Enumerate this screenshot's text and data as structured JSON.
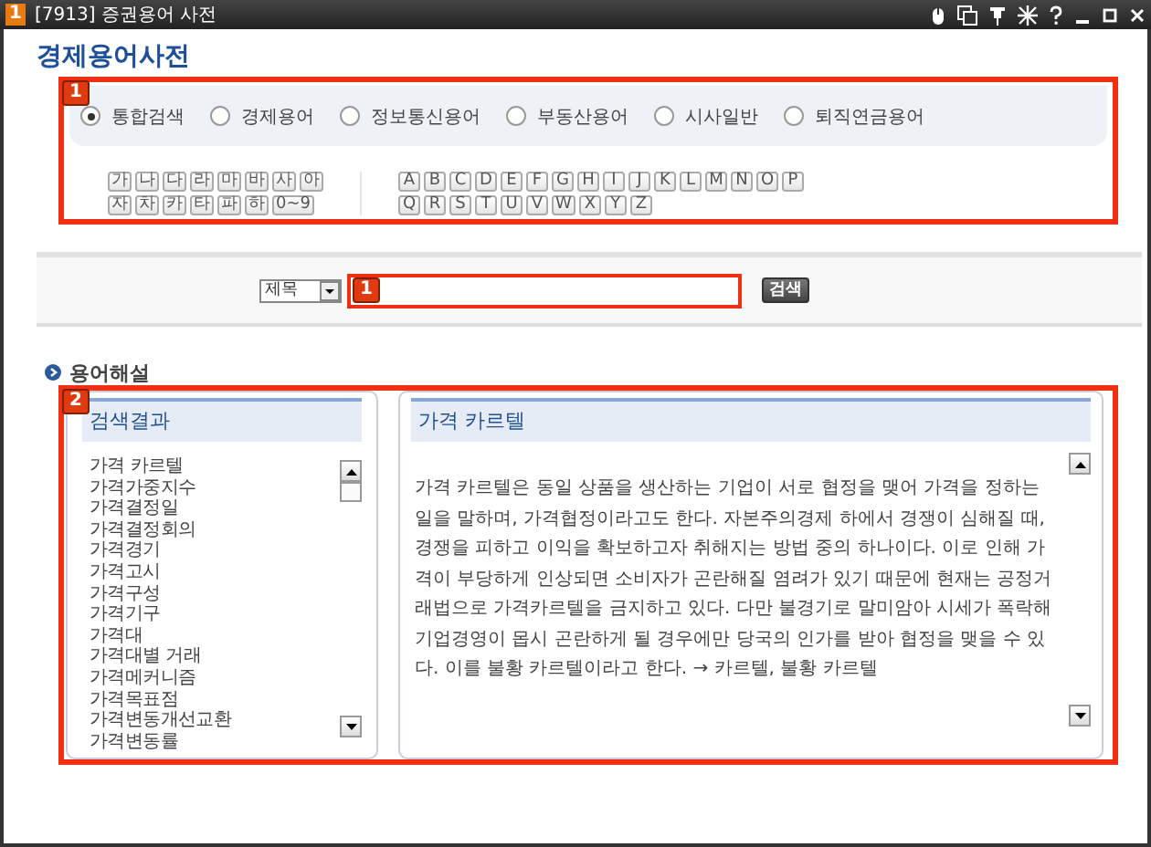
{
  "window": {
    "badge": "1",
    "title": "[7913] 증권용어 사전"
  },
  "heading": "경제용어사전",
  "category_panel": {
    "badge": "1",
    "options": [
      {
        "label": "통합검색",
        "selected": true
      },
      {
        "label": "경제용어",
        "selected": false
      },
      {
        "label": "정보통신용어",
        "selected": false
      },
      {
        "label": "부동산용어",
        "selected": false
      },
      {
        "label": "시사일반",
        "selected": false
      },
      {
        "label": "퇴직연금용어",
        "selected": false
      }
    ],
    "korean_index": [
      [
        "가",
        "나",
        "다",
        "라",
        "마",
        "바",
        "사",
        "아"
      ],
      [
        "자",
        "차",
        "카",
        "타",
        "파",
        "하",
        "0~9"
      ]
    ],
    "alphabet_index": [
      [
        "A",
        "B",
        "C",
        "D",
        "E",
        "F",
        "G",
        "H",
        "I",
        "J",
        "K",
        "L",
        "M",
        "N",
        "O",
        "P"
      ],
      [
        "Q",
        "R",
        "S",
        "T",
        "U",
        "V",
        "W",
        "X",
        "Y",
        "Z"
      ]
    ]
  },
  "search": {
    "field_select": "제목",
    "badge": "1",
    "button": "검색"
  },
  "section_title": "용어해설",
  "results": {
    "badge": "2",
    "title": "검색결과",
    "items": [
      "가격 카르텔",
      "가격가중지수",
      "가격결정일",
      "가격결정회의",
      "가격경기",
      "가격고시",
      "가격구성",
      "가격기구",
      "가격대",
      "가격대별 거래",
      "가격메커니즘",
      "가격목표점",
      "가격변동개선교환",
      "가격변동률"
    ]
  },
  "definition": {
    "title": "가격 카르텔",
    "text": "가격 카르텔은 동일 상품을 생산하는 기업이 서로 협정을 맺어 가격을 정하는 일을 말하며, 가격협정이라고도 한다. 자본주의경제 하에서 경쟁이 심해질 때, 경쟁을 피하고 이익을 확보하고자 취해지는 방법 중의 하나이다. 이로 인해 가격이 부당하게 인상되면 소비자가 곤란해질 염려가 있기 때문에 현재는 공정거래법으로 가격카르텔을 금지하고 있다. 다만 불경기로 말미암아 시세가 폭락해 기업경영이 몹시 곤란하게 될 경우에만 당국의 인가를 받아 협정을 맺을 수 있다. 이를 불황 카르텔이라고 한다. → 카르텔, 불황 카르텔"
  }
}
